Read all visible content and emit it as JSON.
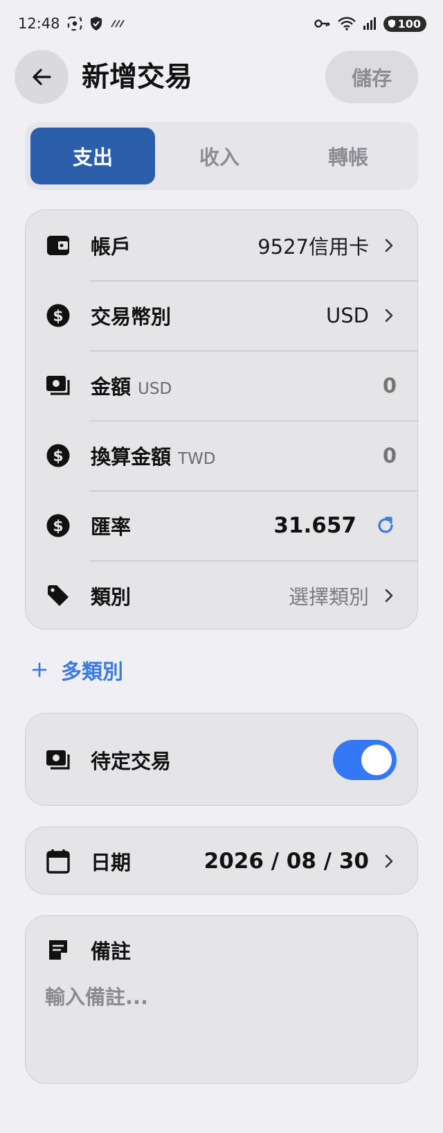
{
  "status_bar": {
    "time": "12:48",
    "battery": "100"
  },
  "header": {
    "title": "新增交易",
    "save_label": "儲存"
  },
  "tabs": [
    {
      "label": "支出",
      "active": true
    },
    {
      "label": "收入",
      "active": false
    },
    {
      "label": "轉帳",
      "active": false
    }
  ],
  "form": {
    "account": {
      "label": "帳戶",
      "value": "9527信用卡"
    },
    "currency": {
      "label": "交易幣別",
      "value": "USD"
    },
    "amount": {
      "label": "金額",
      "unit": "USD",
      "value": "0"
    },
    "converted": {
      "label": "換算金額",
      "unit": "TWD",
      "value": "0"
    },
    "rate": {
      "label": "匯率",
      "value": "31.657"
    },
    "category": {
      "label": "類別",
      "value": "選擇類別"
    }
  },
  "multi_category_label": "多類別",
  "pending": {
    "label": "待定交易",
    "enabled": true
  },
  "date": {
    "label": "日期",
    "value": "2026 / 08 / 30"
  },
  "note": {
    "label": "備註",
    "placeholder": "輸入備註..."
  },
  "colors": {
    "accent": "#2b5eab",
    "link": "#3b7ae0",
    "toggle_on": "#3478f6",
    "background": "#f0f0f4",
    "card": "#e5e5e8"
  }
}
